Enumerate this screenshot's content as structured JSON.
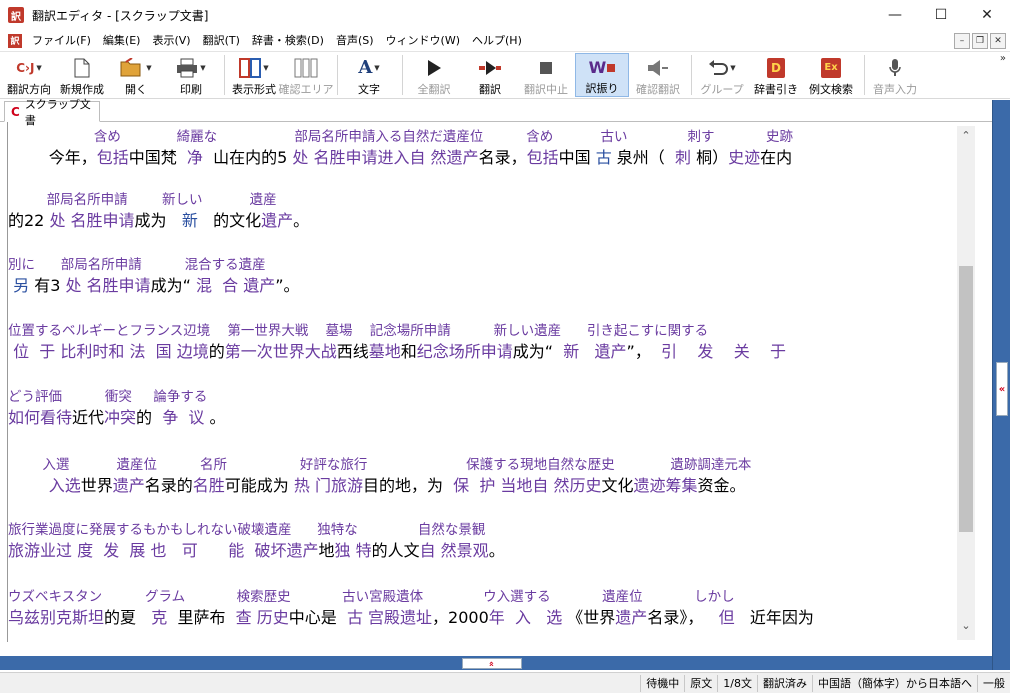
{
  "window": {
    "app_icon": "訳",
    "title": "翻訳エディタ - [スクラップ文書]",
    "minimize": "—",
    "maximize": "☐",
    "close": "✕"
  },
  "menu": {
    "app_icon": "訳",
    "items": [
      "ファイル(F)",
      "編集(E)",
      "表示(V)",
      "翻訳(T)",
      "辞書・検索(D)",
      "音声(S)",
      "ウィンドウ(W)",
      "ヘルプ(H)"
    ],
    "mdi_minimize": "–",
    "mdi_restore": "❐",
    "mdi_close": "✕"
  },
  "toolbar": {
    "buttons": [
      {
        "label": "翻訳方向",
        "icon": "direction-icon",
        "enabled": true
      },
      {
        "label": "新規作成",
        "icon": "new-document-icon",
        "enabled": true
      },
      {
        "label": "開く",
        "icon": "open-folder-icon",
        "enabled": true
      },
      {
        "label": "印刷",
        "icon": "printer-icon",
        "enabled": true
      },
      {
        "label": "表示形式",
        "icon": "view-format-icon",
        "enabled": true
      },
      {
        "label": "確認エリア",
        "icon": "check-area-icon",
        "enabled": false
      },
      {
        "label": "文字",
        "icon": "font-icon",
        "enabled": true
      },
      {
        "label": "全翻訳",
        "icon": "play-icon",
        "enabled": false
      },
      {
        "label": "翻訳",
        "icon": "translate-icon",
        "enabled": true
      },
      {
        "label": "翻訳中止",
        "icon": "stop-icon",
        "enabled": false
      },
      {
        "label": "訳振り",
        "icon": "ruby-translation-icon",
        "enabled": true,
        "active": true
      },
      {
        "label": "確認翻訳",
        "icon": "speaker-icon",
        "enabled": false
      },
      {
        "label": "グループ",
        "icon": "undo-group-icon",
        "enabled": false
      },
      {
        "label": "辞書引き",
        "icon": "dictionary-icon",
        "enabled": true
      },
      {
        "label": "例文検索",
        "icon": "example-search-icon",
        "enabled": true
      },
      {
        "label": "音声入力",
        "icon": "microphone-icon",
        "enabled": false
      }
    ],
    "direction_glyph": "C›J",
    "font_glyph": "A",
    "ruby_glyph": "W",
    "dictionary_glyph": "D",
    "example_glyph": "Ex",
    "overflow": "»"
  },
  "tab": {
    "icon": "C",
    "label": "スクラップ文書"
  },
  "document": {
    "blocks": [
      {
        "ruby": "                    含め             綺麗な                  部局名所申請入る自然だ遺産位          含め           古い              刺す            史跡",
        "text": [
          {
            "t": "        今年，",
            "c": ""
          },
          {
            "t": "包括",
            "c": "hl"
          },
          {
            "t": "中国梵  ",
            "c": ""
          },
          {
            "t": "净",
            "c": "hl"
          },
          {
            "t": "  山在内的5 ",
            "c": ""
          },
          {
            "t": "处 名胜申请进入自 然遗产",
            "c": "hl"
          },
          {
            "t": "名录，",
            "c": ""
          },
          {
            "t": "包括",
            "c": "hl"
          },
          {
            "t": "中国 ",
            "c": ""
          },
          {
            "t": "古",
            "c": "hb"
          },
          {
            "t": " 泉州（  ",
            "c": ""
          },
          {
            "t": "刺",
            "c": "hl"
          },
          {
            "t": " 桐）",
            "c": ""
          },
          {
            "t": "史迹",
            "c": "hl"
          },
          {
            "t": "在内",
            "c": ""
          }
        ]
      },
      {
        "ruby": "         部局名所申請        新しい           遺産",
        "text": [
          {
            "t": "的22 ",
            "c": ""
          },
          {
            "t": "处 名胜申请",
            "c": "hl"
          },
          {
            "t": "成为   ",
            "c": ""
          },
          {
            "t": "新",
            "c": "hb"
          },
          {
            "t": "   的文化",
            "c": ""
          },
          {
            "t": "遺产",
            "c": "hl"
          },
          {
            "t": "。",
            "c": ""
          }
        ]
      },
      {
        "ruby": "別に      部局名所申請          混合する遺産",
        "text": [
          {
            "t": " ",
            "c": ""
          },
          {
            "t": "另",
            "c": "hb"
          },
          {
            "t": " 有3 ",
            "c": ""
          },
          {
            "t": "处 名胜申请",
            "c": "hl"
          },
          {
            "t": "成为“ ",
            "c": ""
          },
          {
            "t": "混  合 遺产",
            "c": "hl"
          },
          {
            "t": "”。",
            "c": ""
          }
        ]
      },
      {
        "ruby": "位置するベルギーとフランス辺境    第一世界大戦    墓場    記念場所申請          新しい遺産      引き起こすに関する",
        "text": [
          {
            "t": " ",
            "c": ""
          },
          {
            "t": "位  于 比利时和 法  国 边境",
            "c": "hl"
          },
          {
            "t": "的",
            "c": ""
          },
          {
            "t": "第一次世界大战",
            "c": "hl"
          },
          {
            "t": "西线",
            "c": ""
          },
          {
            "t": "墓地",
            "c": "hl"
          },
          {
            "t": "和",
            "c": ""
          },
          {
            "t": "纪念场所申请",
            "c": "hl"
          },
          {
            "t": "成为“  ",
            "c": ""
          },
          {
            "t": "新   遺产",
            "c": "hl"
          },
          {
            "t": "”，  ",
            "c": ""
          },
          {
            "t": "引    发    关    于",
            "c": "hl"
          }
        ]
      },
      {
        "ruby": "どう評価          衝突     論争する",
        "text": [
          {
            "t": "如何看待",
            "c": "hl"
          },
          {
            "t": "近代",
            "c": ""
          },
          {
            "t": "冲突",
            "c": "hl"
          },
          {
            "t": "的  ",
            "c": ""
          },
          {
            "t": "争  议",
            "c": "hl"
          },
          {
            "t": " 。",
            "c": ""
          }
        ]
      },
      {
        "ruby": "        入選           遺産位          名所                 好評な旅行                       保護する現地自然な歴史             遺跡調達元本",
        "text": [
          {
            "t": "        ",
            "c": ""
          },
          {
            "t": "入选",
            "c": "hl"
          },
          {
            "t": "世界",
            "c": ""
          },
          {
            "t": "遗产",
            "c": "hl"
          },
          {
            "t": "名录的",
            "c": ""
          },
          {
            "t": "名胜",
            "c": "hl"
          },
          {
            "t": "可能成为 ",
            "c": ""
          },
          {
            "t": "热 门旅游",
            "c": "hl"
          },
          {
            "t": "目的地，为  ",
            "c": ""
          },
          {
            "t": "保  护 当地自 然历史",
            "c": "hl"
          },
          {
            "t": "文化",
            "c": ""
          },
          {
            "t": "遗迹筹集",
            "c": "hl"
          },
          {
            "t": "资金。",
            "c": ""
          }
        ]
      },
      {
        "ruby": "旅行業過度に発展するもかもしれない破壊遺産      独特な              自然な景観",
        "text": [
          {
            "t": "旅游业过 度  发  展 也   可      能  破坏遗产",
            "c": "hl"
          },
          {
            "t": "地",
            "c": ""
          },
          {
            "t": "独 特",
            "c": "hl"
          },
          {
            "t": "的人文",
            "c": ""
          },
          {
            "t": "自 然景观",
            "c": "hl"
          },
          {
            "t": "。",
            "c": ""
          }
        ]
      },
      {
        "ruby": "ウズベキスタン          グラム            検索歴史            古い宮殿遺体              ウ入選する            遺産位            しかし",
        "text": [
          {
            "t": "乌兹别克斯坦",
            "c": "hl"
          },
          {
            "t": "的夏   ",
            "c": ""
          },
          {
            "t": "克",
            "c": "hl"
          },
          {
            "t": "  里萨布  ",
            "c": ""
          },
          {
            "t": "查 历史",
            "c": "hl"
          },
          {
            "t": "中心是  ",
            "c": ""
          },
          {
            "t": "古 宫殿遗址",
            "c": "hl"
          },
          {
            "t": "，2000",
            "c": ""
          },
          {
            "t": "年  入   选",
            "c": "hl"
          },
          {
            "t": " 《世界",
            "c": ""
          },
          {
            "t": "遗产",
            "c": "hl"
          },
          {
            "t": "名录》，   ",
            "c": ""
          },
          {
            "t": "但",
            "c": "hl"
          },
          {
            "t": "   近年因为",
            "c": ""
          }
        ]
      }
    ]
  },
  "scroll": {
    "up": "⌃",
    "down": "⌄"
  },
  "panel": {
    "right_handle": "«",
    "bottom_handle": "»"
  },
  "status": {
    "cells": [
      "待機中",
      "原文",
      "1/8文",
      "翻訳済み",
      "中国語（簡体字）から日本語へ",
      "一般"
    ]
  }
}
